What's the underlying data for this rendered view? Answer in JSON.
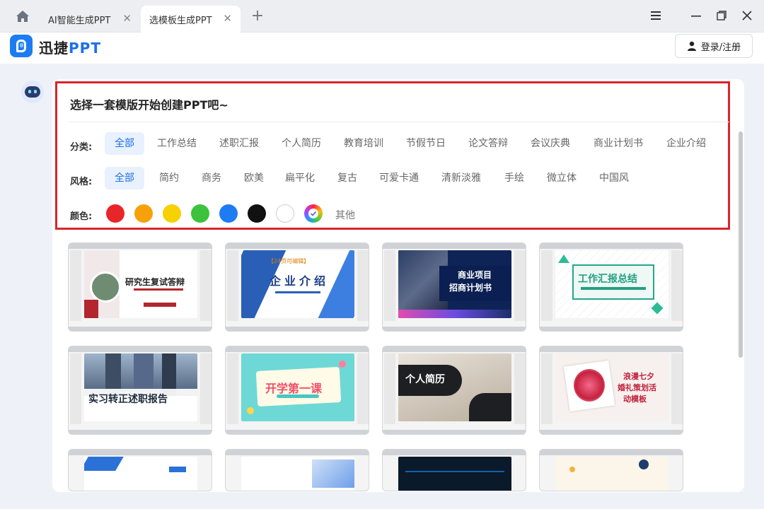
{
  "tabs": [
    {
      "label": "AI智能生成PPT",
      "active": false
    },
    {
      "label": "选模板生成PPT",
      "active": true
    }
  ],
  "header": {
    "brand_prefix": "迅捷",
    "brand_suffix": "PPT",
    "login_label": "登录/注册"
  },
  "panel": {
    "title": "选择一套模版开始创建PPT吧~",
    "category_label": "分类:",
    "categories": [
      "全部",
      "工作总结",
      "述职汇报",
      "个人简历",
      "教育培训",
      "节假节日",
      "论文答辩",
      "会议庆典",
      "商业计划书",
      "企业介绍"
    ],
    "style_label": "风格:",
    "styles": [
      "全部",
      "简约",
      "商务",
      "欧美",
      "扁平化",
      "复古",
      "可爱卡通",
      "清新淡雅",
      "手绘",
      "微立体",
      "中国风"
    ],
    "color_label": "颜色:",
    "colors": [
      "#e8262a",
      "#f7a10a",
      "#f7d100",
      "#3cc23c",
      "#1e7cf2",
      "#111111",
      "#ffffff"
    ],
    "color_other": "其他",
    "active_category": "全部",
    "active_style": "全部"
  },
  "templates": [
    {
      "title": "研究生复试答辩",
      "theme": "red"
    },
    {
      "title": "企业介绍",
      "badge": "【24页可编辑】",
      "theme": "blue"
    },
    {
      "title": "商业项目招商计划书",
      "line1": "商业项目",
      "line2": "招商计划书",
      "theme": "navy"
    },
    {
      "title": "工作汇报总结",
      "theme": "green"
    },
    {
      "title": "实习转正述职报告",
      "theme": "building"
    },
    {
      "title": "开学第一课",
      "theme": "cyan"
    },
    {
      "title": "个人简历",
      "theme": "dark"
    },
    {
      "title": "浪漫七夕婚礼策划活动模板",
      "line1": "浪漫七夕",
      "line2": "婚礼策划活",
      "line3": "动模板",
      "theme": "romance"
    }
  ]
}
